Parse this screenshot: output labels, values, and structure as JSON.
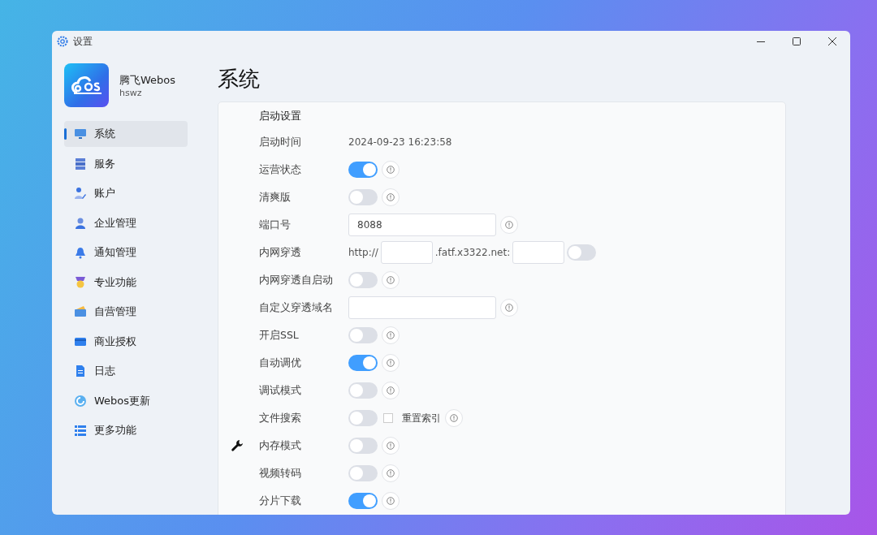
{
  "window": {
    "title": "设置"
  },
  "profile": {
    "name": "腾飞Webos",
    "user": "hswz"
  },
  "sidebar": {
    "items": [
      {
        "label": "系统",
        "selected": true
      },
      {
        "label": "服务",
        "selected": false
      },
      {
        "label": "账户",
        "selected": false
      },
      {
        "label": "企业管理",
        "selected": false
      },
      {
        "label": "通知管理",
        "selected": false
      },
      {
        "label": "专业功能",
        "selected": false
      },
      {
        "label": "自营管理",
        "selected": false
      },
      {
        "label": "商业授权",
        "selected": false
      },
      {
        "label": "日志",
        "selected": false
      },
      {
        "label": "Webos更新",
        "selected": false
      },
      {
        "label": "更多功能",
        "selected": false
      }
    ]
  },
  "page_title": "系统",
  "section_title": "启动设置",
  "settings": [
    {
      "kind": "text",
      "label": "启动时间",
      "value": "2024-09-23 16:23:58"
    },
    {
      "kind": "toggle",
      "label": "运营状态",
      "on": true
    },
    {
      "kind": "toggle",
      "label": "清爽版",
      "on": false
    },
    {
      "kind": "input",
      "label": "端口号",
      "value": "8088"
    },
    {
      "kind": "tunnel",
      "label": "内网穿透",
      "prefix": "http://",
      "middle": ".fatf.x3322.net:",
      "on": false
    },
    {
      "kind": "toggle",
      "label": "内网穿透自启动",
      "on": false
    },
    {
      "kind": "input",
      "label": "自定义穿透域名"
    },
    {
      "kind": "toggle",
      "label": "开启SSL",
      "on": false
    },
    {
      "kind": "toggle",
      "label": "自动调优",
      "on": true
    },
    {
      "kind": "toggle",
      "label": "调试模式",
      "on": false
    },
    {
      "kind": "toggle",
      "label": "文件搜索",
      "on": false,
      "checkbox": {
        "label": "重置索引",
        "checked": false
      }
    },
    {
      "kind": "toggle",
      "label": "内存模式",
      "on": false
    },
    {
      "kind": "toggle",
      "label": "视频转码",
      "on": false
    },
    {
      "kind": "toggle",
      "label": "分片下载",
      "on": true
    }
  ]
}
